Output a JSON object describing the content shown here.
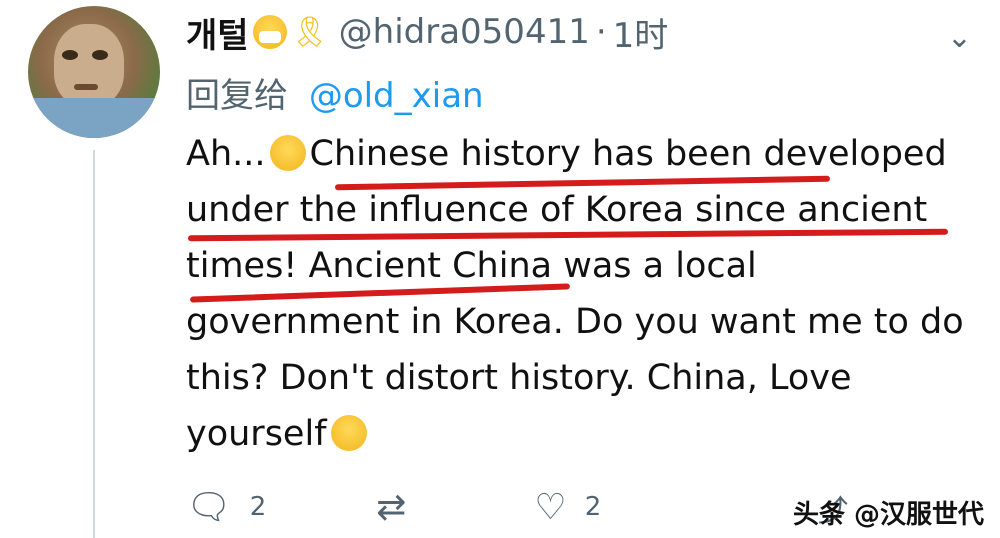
{
  "tweet": {
    "name": "개털",
    "handle": "@hidra050411",
    "dot": "·",
    "time": "1时",
    "reply_prefix": "回复给",
    "reply_handle": "@old_xian",
    "text_part1": "Ah...",
    "text_part2": "Chinese history has been developed under the influence of Korea since ancient times! Ancient China was a local government in Korea. Do you want me to do this? Don't distort history. China, Love yourself",
    "more_icon": "⌄"
  },
  "actions": {
    "reply_count": "2",
    "retweet_count": "",
    "like_count": "2"
  },
  "watermark": "头条 @汉服世代",
  "colors": {
    "handle": "#536471",
    "link": "#1d9bf0",
    "underline": "#d41c1c"
  }
}
